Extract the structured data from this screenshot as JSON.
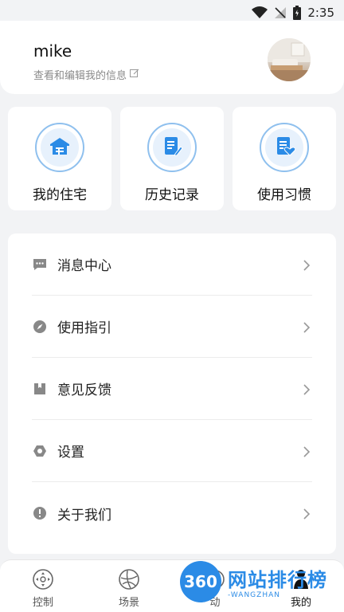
{
  "status_bar": {
    "time": "2:35"
  },
  "profile": {
    "name": "mike",
    "edit_text": "查看和编辑我的信息"
  },
  "shortcuts": [
    {
      "label": "我的住宅",
      "icon": "house-icon"
    },
    {
      "label": "历史记录",
      "icon": "document-edit-icon"
    },
    {
      "label": "使用习惯",
      "icon": "document-heart-icon"
    }
  ],
  "menu": [
    {
      "label": "消息中心",
      "icon": "message-icon"
    },
    {
      "label": "使用指引",
      "icon": "compass-icon"
    },
    {
      "label": "意见反馈",
      "icon": "book-icon"
    },
    {
      "label": "设置",
      "icon": "settings-icon"
    },
    {
      "label": "关于我们",
      "icon": "info-icon"
    }
  ],
  "tabbar": [
    {
      "label": "控制",
      "icon": "control-icon"
    },
    {
      "label": "场景",
      "icon": "scene-icon"
    },
    {
      "label": "动",
      "icon": "activity-icon"
    },
    {
      "label": "我的",
      "icon": "person-icon",
      "active": true
    }
  ],
  "watermark": {
    "badge": "360",
    "title": "网站排行榜",
    "subtitle": "-WANGZHAN"
  },
  "colors": {
    "accent": "#2b8be6",
    "icon_bg": "#e7f1fc",
    "icon_ring": "#8fc0ee",
    "background": "#f2f3f5"
  }
}
